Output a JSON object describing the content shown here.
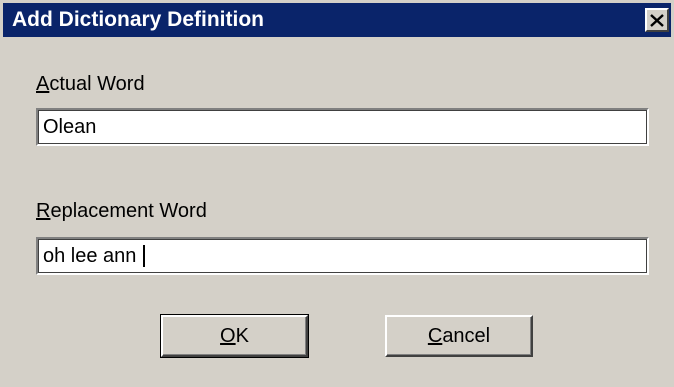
{
  "window": {
    "title": "Add Dictionary Definition",
    "close_glyph": "close-icon"
  },
  "form": {
    "actual_word": {
      "label_mnemonic": "A",
      "label_rest": "ctual Word",
      "value": "Olean"
    },
    "replacement_word": {
      "label_mnemonic": "R",
      "label_rest": "eplacement Word",
      "value": "oh lee ann"
    }
  },
  "buttons": {
    "ok": {
      "mnemonic": "O",
      "rest": "K"
    },
    "cancel": {
      "mnemonic": "C",
      "rest": "ancel"
    }
  },
  "colors": {
    "title_bar": "#0a246a",
    "dialog_bg": "#d4d0c8"
  }
}
